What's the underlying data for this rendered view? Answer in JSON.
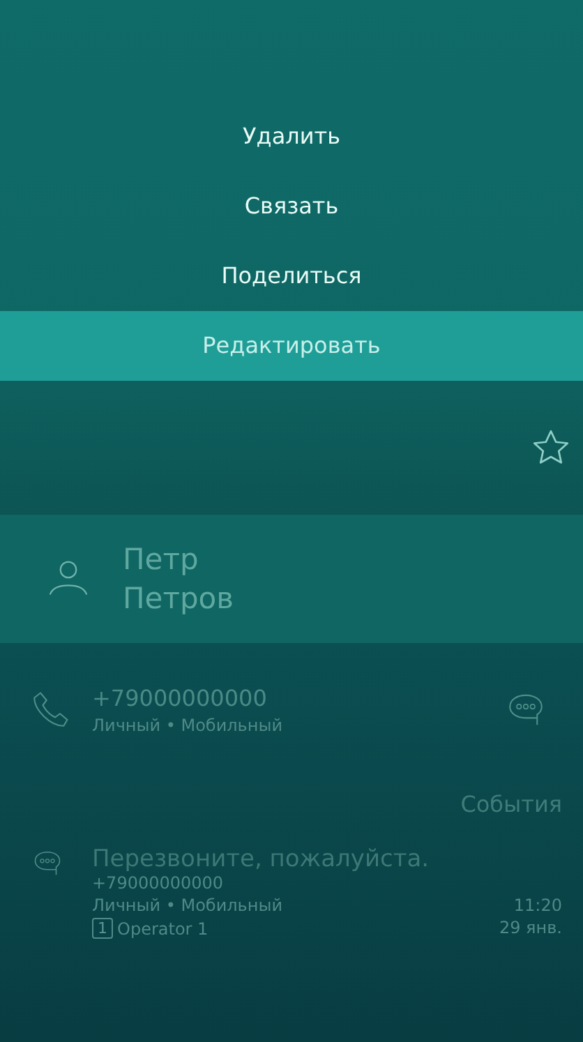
{
  "menu": [
    {
      "label": "Удалить",
      "selected": false
    },
    {
      "label": "Связать",
      "selected": false
    },
    {
      "label": "Поделиться",
      "selected": false
    },
    {
      "label": "Редактировать",
      "selected": true
    }
  ],
  "contact": {
    "favorite": false,
    "first_name": "Петр",
    "last_name": "Петров"
  },
  "phone": {
    "number": "+79000000000",
    "type": "Личный • Мобильный"
  },
  "events_header": "События",
  "events": [
    {
      "text": "Перезвоните, пожалуйста.",
      "number": "+79000000000",
      "type": "Личный • Мобильный",
      "time": "11:20",
      "sim": "1",
      "operator": "Operator 1",
      "date": "29 янв."
    }
  ]
}
